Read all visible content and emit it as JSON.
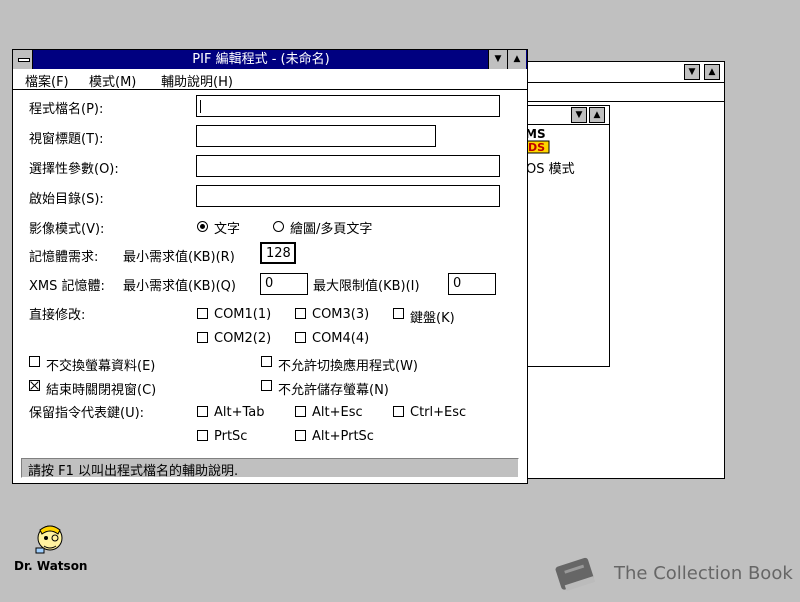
{
  "main_window": {
    "title": "PIF 編輯程式 - (未命名)",
    "menu": [
      {
        "label": "檔案(F)"
      },
      {
        "label": "模式(M)"
      },
      {
        "label": "輔助說明(H)"
      }
    ],
    "fields": {
      "program_filename": {
        "label": "程式檔名(P):",
        "value": ""
      },
      "window_title": {
        "label": "視窗標題(T):",
        "value": ""
      },
      "optional_params": {
        "label": "選擇性參數(O):",
        "value": ""
      },
      "start_dir": {
        "label": "啟始目錄(S):",
        "value": ""
      }
    },
    "video_mode": {
      "label": "影像模式(V):",
      "options": [
        {
          "label": "文字",
          "selected": true
        },
        {
          "label": "繪圖/多頁文字",
          "selected": false
        }
      ]
    },
    "memory": {
      "label": "記憶體需求:",
      "min_label": "最小需求值(KB)(R)",
      "min_value": "128"
    },
    "xms": {
      "label": "XMS 記憶體:",
      "min_label": "最小需求值(KB)(Q)",
      "min_value": "0",
      "max_label": "最大限制值(KB)(I)",
      "max_value": "0"
    },
    "direct_modify": {
      "label": "直接修改:",
      "options": [
        {
          "label": "COM1(1)",
          "checked": false
        },
        {
          "label": "COM3(3)",
          "checked": false
        },
        {
          "label": "鍵盤(K)",
          "checked": false
        },
        {
          "label": "COM2(2)",
          "checked": false
        },
        {
          "label": "COM4(4)",
          "checked": false
        }
      ]
    },
    "flags": [
      {
        "label": "不交換螢幕資料(E)",
        "checked": false
      },
      {
        "label": "不允許切換應用程式(W)",
        "checked": false
      },
      {
        "label": "結束時關閉視窗(C)",
        "checked": true
      },
      {
        "label": "不允許儲存螢幕(N)",
        "checked": false
      }
    ],
    "reserve_keys": {
      "label": "保留指令代表鍵(U):",
      "options": [
        {
          "label": "Alt+Tab",
          "checked": false
        },
        {
          "label": "Alt+Esc",
          "checked": false
        },
        {
          "label": "Ctrl+Esc",
          "checked": false
        },
        {
          "label": "PrtSc",
          "checked": false
        },
        {
          "label": "Alt+PrtSc",
          "checked": false
        }
      ]
    },
    "status_text": "請按 F1 以叫出程式檔名的輔助說明."
  },
  "background_window": {
    "icon_text": "MS DOS",
    "label": "OS 模式"
  },
  "desktop_icon": {
    "label": "Dr. Watson",
    "icon": "dr-watson-icon"
  },
  "watermark": {
    "text": "The Collection Book",
    "icon": "book-icon"
  },
  "colors": {
    "desktop": "#c0c0c0",
    "titlebar": "#000080"
  }
}
